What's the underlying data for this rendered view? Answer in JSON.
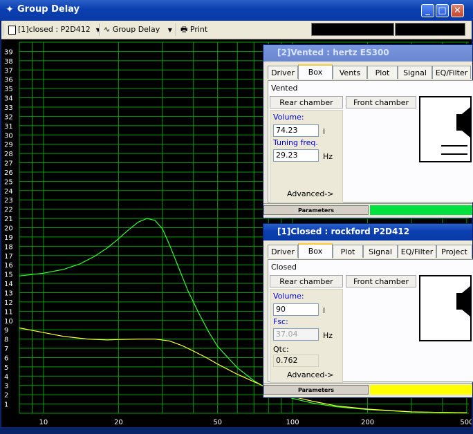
{
  "window": {
    "title": "Group Delay",
    "controls": {
      "minimize": "_",
      "maximize": "□",
      "close": "✕"
    }
  },
  "toolbar": {
    "project_selector": "[1]closed : P2D412",
    "view_selector": "Group Delay",
    "print_label": "Print"
  },
  "chart_data": {
    "type": "line",
    "xscale": "log",
    "xlim": [
      8,
      510
    ],
    "ylim": [
      0,
      40
    ],
    "grid": true,
    "x_tick_labels": [
      "10",
      "20",
      "50",
      "100",
      "200",
      "500"
    ],
    "x_ticks": [
      10,
      20,
      50,
      100,
      200,
      500
    ],
    "y_tick_labels": [
      "1",
      "2",
      "3",
      "4",
      "5",
      "6",
      "7",
      "8",
      "9",
      "10",
      "11",
      "12",
      "13",
      "14",
      "15",
      "16",
      "17",
      "18",
      "19",
      "20",
      "21",
      "22",
      "23",
      "24",
      "25",
      "26",
      "27",
      "28",
      "29",
      "30",
      "31",
      "32",
      "33",
      "34",
      "35",
      "36",
      "37",
      "38",
      "39"
    ],
    "series": [
      {
        "color": "#33ff33",
        "x": [
          8,
          10,
          12,
          14,
          16,
          18,
          20,
          22,
          24,
          26,
          28,
          30,
          32,
          35,
          38,
          42,
          46,
          50,
          60,
          70,
          80,
          100,
          120,
          150,
          200,
          300,
          500
        ],
        "y": [
          14.8,
          15.1,
          15.5,
          16.1,
          16.9,
          17.8,
          18.8,
          19.8,
          20.6,
          21.0,
          20.8,
          19.9,
          18.2,
          15.6,
          13.2,
          10.8,
          8.8,
          7.2,
          4.9,
          3.5,
          2.6,
          1.6,
          1.1,
          0.7,
          0.4,
          0.15,
          0.05
        ]
      },
      {
        "color": "#ffff33",
        "x": [
          8,
          10,
          12,
          15,
          18,
          20,
          24,
          28,
          32,
          36,
          40,
          45,
          50,
          60,
          70,
          80,
          100,
          120,
          150,
          200,
          300,
          500
        ],
        "y": [
          9.2,
          8.7,
          8.3,
          8.0,
          7.9,
          7.95,
          8.0,
          8.0,
          7.8,
          7.3,
          6.7,
          6.0,
          5.3,
          4.2,
          3.4,
          2.7,
          1.8,
          1.3,
          0.8,
          0.45,
          0.15,
          0.05
        ]
      }
    ]
  },
  "vented_panel": {
    "title": "[2]Vented : hertz ES300",
    "tabs": [
      "Driver",
      "Box",
      "Vents",
      "Plot",
      "Signal",
      "EQ/Filter"
    ],
    "box_type": "Vented",
    "rear_chamber": "Rear chamber",
    "front_chamber": "Front chamber",
    "volume_label": "Volume:",
    "volume_value": "74.23",
    "volume_unit": "l",
    "tuning_label": "Tuning freq.",
    "tuning_value": "29.23",
    "tuning_unit": "Hz",
    "advanced": "Advanced->",
    "status_label": "Parameters",
    "status_color": "#00e040"
  },
  "closed_panel": {
    "title": "[1]Closed : rockford  P2D412",
    "tabs": [
      "Driver",
      "Box",
      "Plot",
      "Signal",
      "EQ/Filter",
      "Project"
    ],
    "box_type": "Closed",
    "rear_chamber": "Rear chamber",
    "front_chamber": "Front chamber",
    "volume_label": "Volume:",
    "volume_value": "90",
    "volume_unit": "l",
    "fsc_label": "Fsc:",
    "fsc_value": "37.04",
    "fsc_unit": "Hz",
    "qtc_label": "Qtc:",
    "qtc_value": "0.762",
    "advanced": "Advanced->",
    "status_label": "Parameters",
    "status_color": "#ffff00"
  }
}
